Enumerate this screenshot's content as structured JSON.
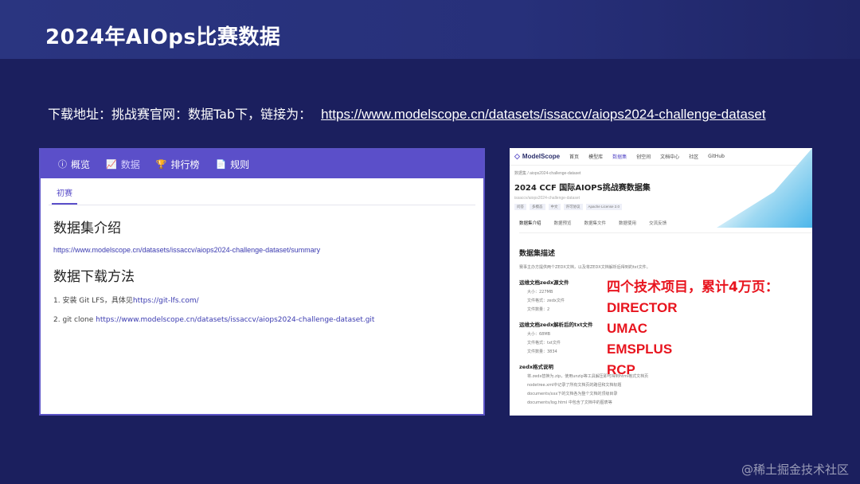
{
  "slide": {
    "title": "2024年AIOps比赛数据",
    "link_prefix": "下载地址：挑战赛官网：数据Tab下，链接为：",
    "link_url": "https://www.modelscope.cn/datasets/issaccv/aiops2024-challenge-dataset",
    "watermark": "@稀土掘金技术社区"
  },
  "left_shot": {
    "tabs": [
      {
        "icon": "ⓘ",
        "label": "概览"
      },
      {
        "icon": "📈",
        "label": "数据"
      },
      {
        "icon": "🏆",
        "label": "排行榜"
      },
      {
        "icon": "📄",
        "label": "规则"
      }
    ],
    "subtab": "初赛",
    "section1_heading": "数据集介绍",
    "section1_link": "https://www.modelscope.cn/datasets/issaccv/aiops2024-challenge-dataset/summary",
    "section2_heading": "数据下载方法",
    "step1_prefix": "1. 安装 Git LFS，具体见",
    "step1_link": "https://git-lfs.com/",
    "step2_prefix": "2.  git clone ",
    "step2_link": "https://www.modelscope.cn/datasets/issaccv/aiops2024-challenge-dataset.git"
  },
  "right_shot": {
    "logo": "ModelScope",
    "nav": [
      "首页",
      "模型库",
      "数据集",
      "创空间",
      "文档中心",
      "社区",
      "GitHub"
    ],
    "crumb": "数据集 / aiops2024-challenge-dataset",
    "title": "2024 CCF 国际AIOPS挑战赛数据集",
    "meta": "issaccv/aiops2024-challenge-dataset",
    "tags": [
      "问答",
      "多模态",
      "中文",
      "许可协议",
      "Apache License 2.0"
    ],
    "subtabs": [
      "数据集介绍",
      "数据预览",
      "数据集文件",
      "数据使用",
      "交流反馈"
    ],
    "h": "数据集描述",
    "p": "赛事主办方提供两个ZEDX文档，以及将ZEDX文档解析后得到的txt文件。",
    "h2a": "运维文档zedx源文件",
    "la": [
      "大小：227MB",
      "文件格式：zedx文件",
      "文件数量：2"
    ],
    "h2b": "运维文档zedx解析后的txt文件",
    "lb": [
      "大小：68MB",
      "文件格式：txt文件",
      "文件数量：3834"
    ],
    "h2c": "zedx格式说明",
    "lc": [
      "将.zedx替换为.zip，使用unzip等工具解压即可得到html格式文档页",
      "nodetree.xml中记录了所有文档页的路径和文档标题",
      "documents/xxx下的文档各为整个文档的顶级目录",
      "documents/log.html 中包含了文档中的图表等"
    ],
    "callout_heading": "四个技术项目，累计4万页：",
    "projects": [
      "DIRECTOR",
      "UMAC",
      "EMSPLUS",
      "RCP"
    ]
  }
}
